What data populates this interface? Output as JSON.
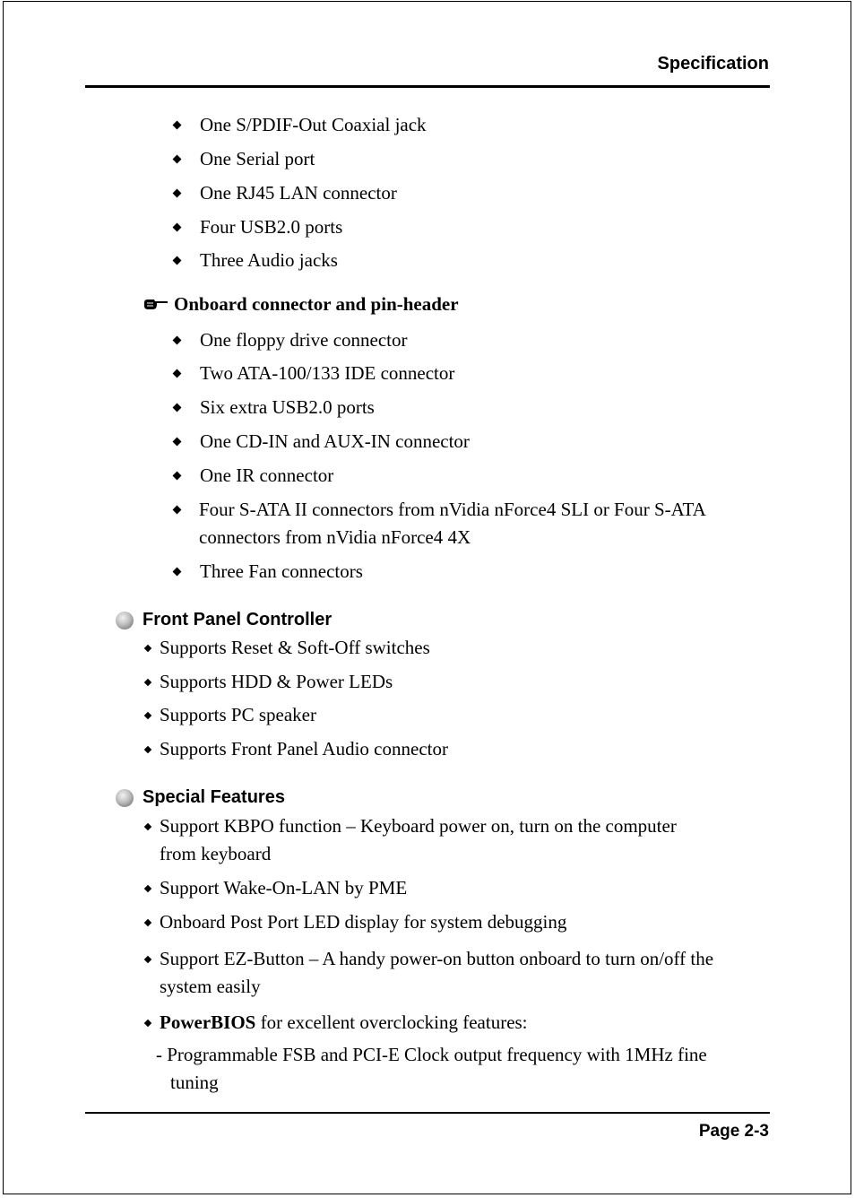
{
  "header": {
    "title": "Specification"
  },
  "footer": {
    "page": "Page 2-3"
  },
  "rear_panel_items": [
    "One S/PDIF-Out Coaxial jack",
    "One Serial port",
    "One RJ45 LAN connector",
    "Four USB2.0 ports",
    "Three Audio jacks"
  ],
  "onboard": {
    "heading": "Onboard connector and pin-header",
    "icon": "pointing-hand-icon",
    "items": [
      "One floppy drive connector",
      "Two ATA-100/133 IDE connector",
      "Six extra USB2.0 ports",
      "One CD-IN and AUX-IN connector",
      "One IR connector",
      "Four S-ATA II connectors from nVidia nForce4 SLI or Four S-ATA",
      "connectors from nVidia nForce4 4X",
      "Three Fan connectors"
    ]
  },
  "front_panel": {
    "heading": "Front Panel Controller",
    "icon": "sphere-bullet-icon",
    "items": [
      "Supports Reset & Soft-Off switches",
      "Supports HDD & Power LEDs",
      "Supports PC speaker",
      "Supports Front Panel Audio connector"
    ]
  },
  "special": {
    "heading": "Special Features",
    "icon": "sphere-bullet-icon",
    "items": [
      "Support KBPO function – Keyboard power on, turn on the computer",
      "from keyboard",
      "Support Wake-On-LAN by PME",
      "Onboard Post Port LED display for system debugging",
      "Support EZ-Button – A handy power-on button onboard to turn on/off the",
      "system easily"
    ],
    "powerbios_bold": "PowerBIOS",
    "powerbios_rest": " for excellent overclocking features:",
    "sub_items": [
      "- Programmable FSB and PCI-E Clock output frequency with 1MHz fine",
      "tuning"
    ]
  }
}
